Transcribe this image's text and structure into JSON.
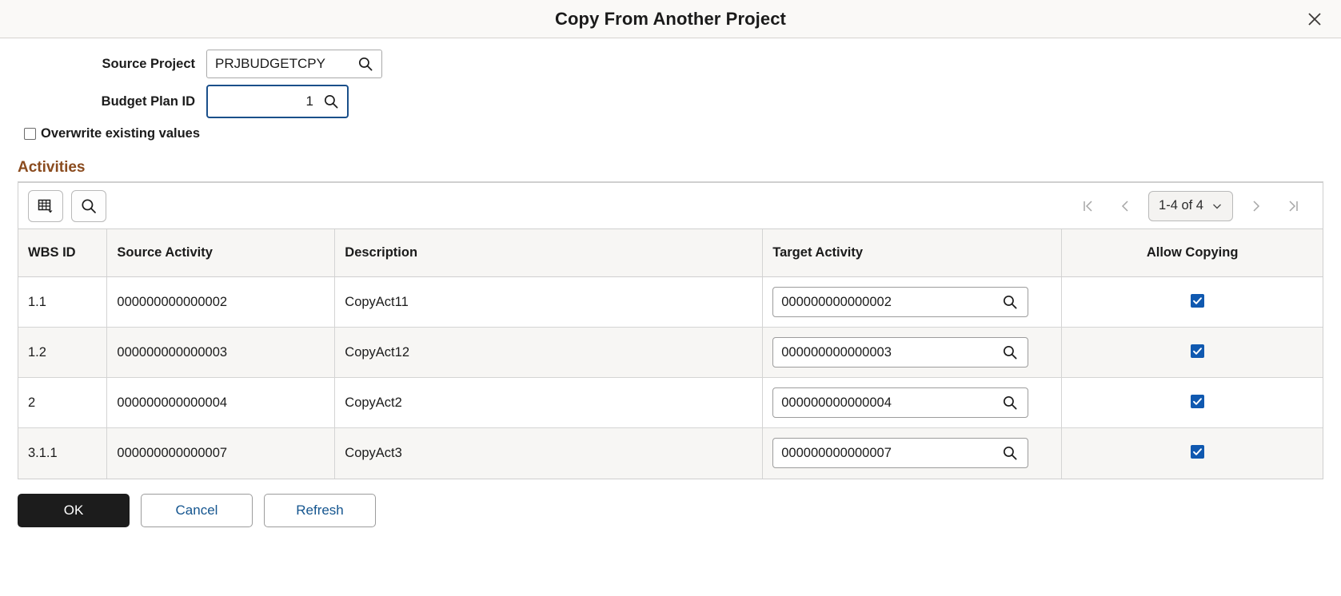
{
  "modal": {
    "title": "Copy From Another Project",
    "close_icon": "close-icon"
  },
  "form": {
    "source_project": {
      "label": "Source Project",
      "value": "PRJBUDGETCPY",
      "placeholder": "",
      "lookup_icon": "search-icon"
    },
    "budget_plan_id": {
      "label": "Budget Plan ID",
      "value": "1",
      "placeholder": "",
      "lookup_icon": "search-icon",
      "focus_color": "#1a4f8a"
    },
    "overwrite": {
      "label": "Overwrite existing values",
      "checked": false
    }
  },
  "grid": {
    "title": "Activities",
    "title_color": "#8a4b1e",
    "toolbar": {
      "personalize_icon": "grid-personalize-icon",
      "find_icon": "search-icon"
    },
    "pager": {
      "first_icon": "first-page-icon",
      "prev_icon": "previous-page-icon",
      "range_label": "1-4 of 4",
      "dropdown_icon": "chevron-down-icon",
      "next_icon": "next-page-icon",
      "last_icon": "last-page-icon"
    },
    "columns": [
      "WBS ID",
      "Source Activity",
      "Description",
      "Target Activity",
      "Allow Copying"
    ],
    "rows": [
      {
        "wbs_id": "1.1",
        "source_activity": "000000000000002",
        "description": "CopyAct11",
        "target_activity": "000000000000002",
        "allow_copying": true
      },
      {
        "wbs_id": "1.2",
        "source_activity": "000000000000003",
        "description": "CopyAct12",
        "target_activity": "000000000000003",
        "allow_copying": true
      },
      {
        "wbs_id": "2",
        "source_activity": "000000000000004",
        "description": "CopyAct2",
        "target_activity": "000000000000004",
        "allow_copying": true
      },
      {
        "wbs_id": "3.1.1",
        "source_activity": "000000000000007",
        "description": "CopyAct3",
        "target_activity": "000000000000007",
        "allow_copying": true
      }
    ],
    "checkbox_color": "#1059b0"
  },
  "footer": {
    "ok_label": "OK",
    "cancel_label": "Cancel",
    "refresh_label": "Refresh",
    "primary_color": "#1c1c1c",
    "link_color": "#14558f"
  }
}
